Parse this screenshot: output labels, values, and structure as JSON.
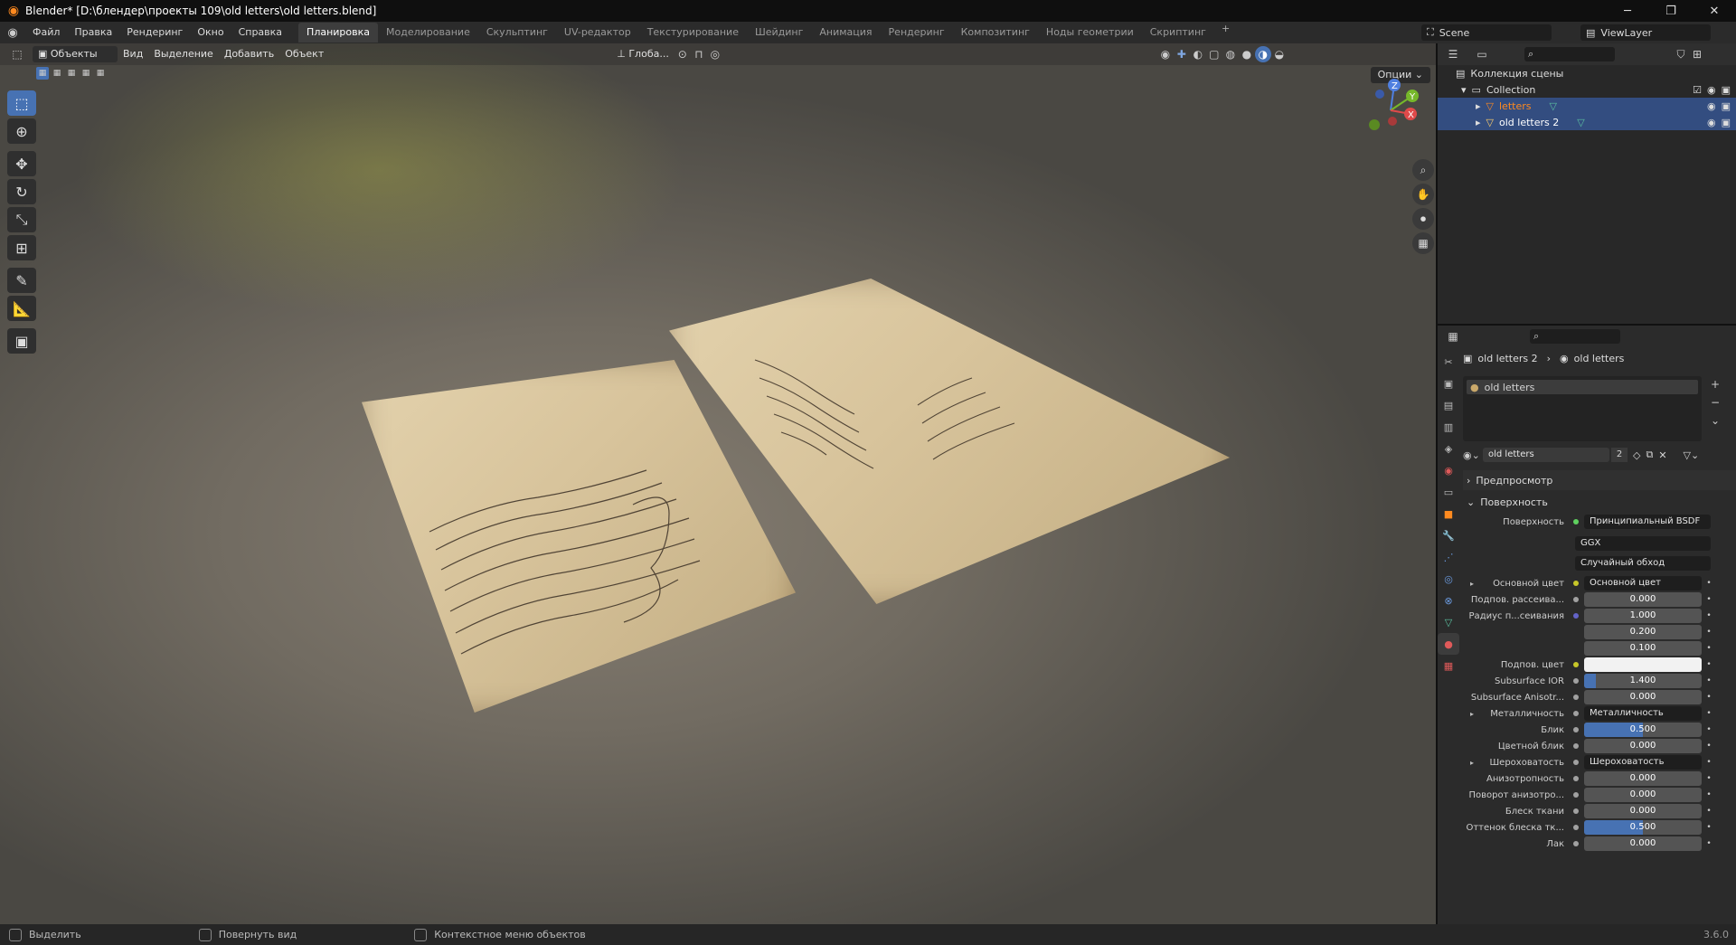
{
  "window": {
    "title": "Blender* [D:\\блендер\\проекты 109\\old letters\\old letters.blend]",
    "min": "─",
    "max": "❐",
    "close": "✕"
  },
  "menu": [
    "Файл",
    "Правка",
    "Рендеринг",
    "Окно",
    "Справка"
  ],
  "workspaces": [
    "Планировка",
    "Моделирование",
    "Скульптинг",
    "UV-редактор",
    "Текстурирование",
    "Шейдинг",
    "Анимация",
    "Рендеринг",
    "Композитинг",
    "Ноды геометрии",
    "Скриптинг"
  ],
  "active_workspace": "Планировка",
  "add_workspace": "+",
  "scene": "Scene",
  "view_layer": "ViewLayer",
  "viewport": {
    "mode": "Объекты",
    "menus": [
      "Вид",
      "Выделение",
      "Добавить",
      "Объект"
    ],
    "orientation": "Глоба...",
    "options": "Опции",
    "gizmo": {
      "z": "Z",
      "y": "Y",
      "x": "X"
    }
  },
  "outliner": {
    "scene_collection": "Коллекция сцены",
    "collection": "Collection",
    "items": [
      {
        "name": "letters"
      },
      {
        "name": "old letters 2"
      }
    ]
  },
  "properties": {
    "breadcrumb": [
      "old letters 2",
      "old letters"
    ],
    "slot": "old letters",
    "material_name": "old letters",
    "users": "2",
    "sections": {
      "preview": "Предпросмотр",
      "surface": "Поверхность"
    },
    "surface_label": "Поверхность",
    "surface_value": "Принципиальный BSDF",
    "distribution": "GGX",
    "subsurface_method": "Случайный обход",
    "rows": [
      {
        "label": "Основной цвет",
        "type": "link",
        "value": "Основной цвет",
        "sock": "y",
        "arrow": true
      },
      {
        "label": "Подпов. рассеива...",
        "type": "num",
        "value": "0.000",
        "sock": "g"
      },
      {
        "label": "Радиус п...сеивания",
        "type": "num",
        "value": "1.000",
        "sock": "b"
      },
      {
        "label": "",
        "type": "num",
        "value": "0.200",
        "sock": ""
      },
      {
        "label": "",
        "type": "num",
        "value": "0.100",
        "sock": ""
      },
      {
        "label": "Подпов. цвет",
        "type": "color",
        "value": "",
        "sock": "y"
      },
      {
        "label": "Subsurface IOR",
        "type": "num",
        "value": "1.400",
        "sock": "g",
        "fill": 0.1
      },
      {
        "label": "Subsurface Anisotr...",
        "type": "num",
        "value": "0.000",
        "sock": "g"
      },
      {
        "label": "Металличность",
        "type": "link",
        "value": "Металличность",
        "sock": "g",
        "arrow": true
      },
      {
        "label": "Блик",
        "type": "num",
        "value": "0.500",
        "sock": "g",
        "fill": 0.5
      },
      {
        "label": "Цветной блик",
        "type": "num",
        "value": "0.000",
        "sock": "g"
      },
      {
        "label": "Шероховатость",
        "type": "link",
        "value": "Шероховатость",
        "sock": "g",
        "arrow": true
      },
      {
        "label": "Анизотропность",
        "type": "num",
        "value": "0.000",
        "sock": "g"
      },
      {
        "label": "Поворот анизотро...",
        "type": "num",
        "value": "0.000",
        "sock": "g"
      },
      {
        "label": "Блеск ткани",
        "type": "num",
        "value": "0.000",
        "sock": "g"
      },
      {
        "label": "Оттенок блеска тк...",
        "type": "num",
        "value": "0.500",
        "sock": "g",
        "fill": 0.5
      },
      {
        "label": "Лак",
        "type": "num",
        "value": "0.000",
        "sock": "g"
      }
    ]
  },
  "status": {
    "select": "Выделить",
    "rotate": "Повернуть вид",
    "context": "Контекстное меню объектов",
    "version": "3.6.0"
  },
  "colors": {
    "accent": "#4772b3",
    "selection": "#334d80",
    "active_object": "#ff8a1f"
  }
}
